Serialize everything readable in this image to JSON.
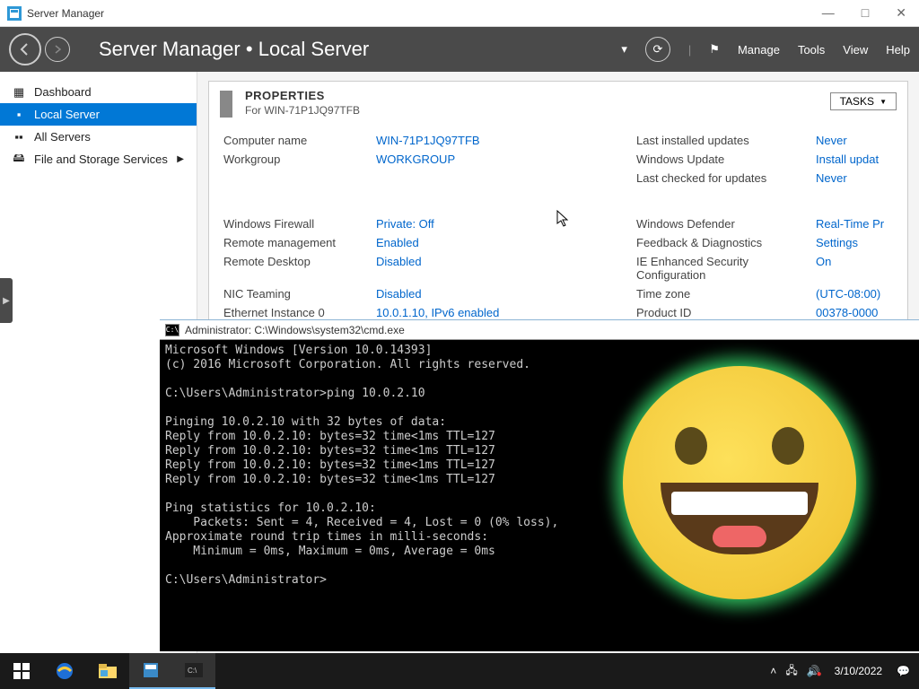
{
  "titlebar": {
    "app": "Server Manager"
  },
  "ribbon": {
    "crumb1": "Server Manager",
    "crumb2": "Local Server",
    "menu": {
      "manage": "Manage",
      "tools": "Tools",
      "view": "View",
      "help": "Help"
    }
  },
  "sidebar": {
    "items": [
      {
        "label": "Dashboard"
      },
      {
        "label": "Local Server"
      },
      {
        "label": "All Servers"
      },
      {
        "label": "File and Storage Services"
      }
    ]
  },
  "panel": {
    "title": "PROPERTIES",
    "sub": "For WIN-71P1JQ97TFB",
    "tasks": "TASKS"
  },
  "props": {
    "l": {
      "computer_name": "Computer name",
      "workgroup": "Workgroup",
      "firewall": "Windows Firewall",
      "remote_mgmt": "Remote management",
      "remote_desktop": "Remote Desktop",
      "nic_teaming": "NIC Teaming",
      "eth0": "Ethernet Instance 0"
    },
    "v": {
      "computer_name": "WIN-71P1JQ97TFB",
      "workgroup": "WORKGROUP",
      "firewall": "Private: Off",
      "remote_mgmt": "Enabled",
      "remote_desktop": "Disabled",
      "nic_teaming": "Disabled",
      "eth0": "10.0.1.10, IPv6 enabled"
    },
    "r": {
      "last_installed": "Last installed updates",
      "win_update": "Windows Update",
      "last_checked": "Last checked for updates",
      "defender": "Windows Defender",
      "feedback": "Feedback & Diagnostics",
      "ie_esc": "IE Enhanced Security Configuration",
      "timezone": "Time zone",
      "product_id": "Product ID"
    },
    "rv": {
      "last_installed": "Never",
      "win_update": "Install updat",
      "last_checked": "Never",
      "defender": "Real-Time Pr",
      "feedback": "Settings",
      "ie_esc": "On",
      "timezone": "(UTC-08:00)",
      "product_id": "00378-0000"
    }
  },
  "cmd": {
    "title": "Administrator: C:\\Windows\\system32\\cmd.exe",
    "body": "Microsoft Windows [Version 10.0.14393]\n(c) 2016 Microsoft Corporation. All rights reserved.\n\nC:\\Users\\Administrator>ping 10.0.2.10\n\nPinging 10.0.2.10 with 32 bytes of data:\nReply from 10.0.2.10: bytes=32 time<1ms TTL=127\nReply from 10.0.2.10: bytes=32 time<1ms TTL=127\nReply from 10.0.2.10: bytes=32 time<1ms TTL=127\nReply from 10.0.2.10: bytes=32 time<1ms TTL=127\n\nPing statistics for 10.0.2.10:\n    Packets: Sent = 4, Received = 4, Lost = 0 (0% loss),\nApproximate round trip times in milli-seconds:\n    Minimum = 0ms, Maximum = 0ms, Average = 0ms\n\nC:\\Users\\Administrator>"
  },
  "taskbar": {
    "date": "3/10/2022"
  }
}
